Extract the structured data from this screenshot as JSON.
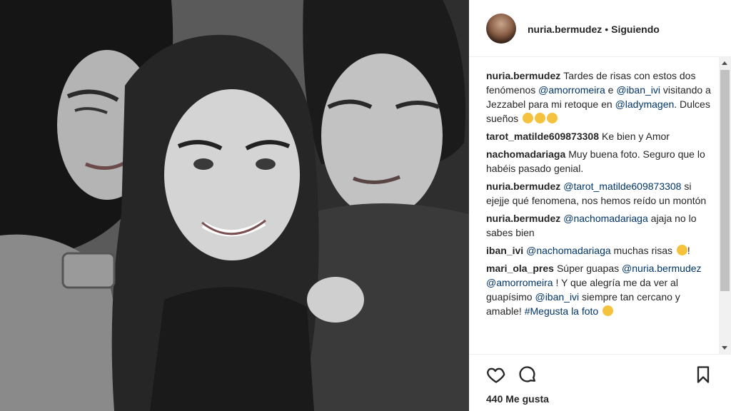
{
  "header": {
    "username": "nuria.bermudez",
    "separator": "•",
    "follow_status": "Siguiendo"
  },
  "comments": [
    {
      "user": "nuria.bermudez",
      "parts": [
        {
          "t": "Tardes de risas con estos dos fenómenos "
        },
        {
          "m": "@amorromeira"
        },
        {
          "t": " e "
        },
        {
          "m": "@iban_ivi"
        },
        {
          "t": " visitando a Jezzabel para mi retoque en "
        },
        {
          "m": "@ladymagen"
        },
        {
          "t": ". Dulces sueños "
        },
        {
          "e": "kiss-emoji"
        },
        {
          "e": "kiss-emoji"
        },
        {
          "e": "kiss-emoji"
        }
      ]
    },
    {
      "user": "tarot_matilde609873308",
      "parts": [
        {
          "t": "Ke bien y Amor"
        }
      ]
    },
    {
      "user": "nachomadariaga",
      "parts": [
        {
          "t": "Muy buena foto. Seguro que lo habéis pasado genial."
        }
      ]
    },
    {
      "user": "nuria.bermudez",
      "parts": [
        {
          "m": "@tarot_matilde609873308"
        },
        {
          "t": " si ejejje qué fenomena, nos hemos reído un montón"
        }
      ]
    },
    {
      "user": "nuria.bermudez",
      "parts": [
        {
          "m": "@nachomadariaga"
        },
        {
          "t": " ajaja no lo sabes bien"
        }
      ]
    },
    {
      "user": "iban_ivi",
      "parts": [
        {
          "m": "@nachomadariaga"
        },
        {
          "t": " muchas risas "
        },
        {
          "e": "rofl-emoji"
        },
        {
          "t": "!"
        }
      ]
    },
    {
      "user": "mari_ola_pres",
      "parts": [
        {
          "t": "Súper guapas "
        },
        {
          "m": "@nuria.bermudez"
        },
        {
          "t": " "
        },
        {
          "m": "@amorromeira"
        },
        {
          "t": " ! Y que alegría me da ver al guapísimo "
        },
        {
          "m": "@iban_ivi"
        },
        {
          "t": " siempre tan cercano y amable! "
        },
        {
          "m": "#Megusta la foto"
        },
        {
          "t": " "
        },
        {
          "e": "smile-emoji"
        }
      ]
    }
  ],
  "actions": {
    "like_icon": "heart-icon",
    "comment_icon": "comment-icon",
    "save_icon": "bookmark-icon",
    "likes_text": "440 Me gusta"
  },
  "colors": {
    "mention": "#003569",
    "text": "#262626",
    "divider": "#efefef"
  }
}
